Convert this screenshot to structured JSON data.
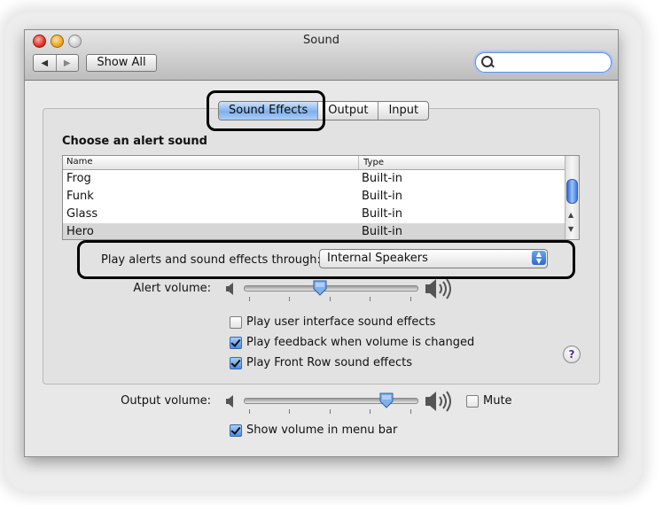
{
  "window": {
    "title": "Sound"
  },
  "toolbar": {
    "nav_back": "◀",
    "nav_forward": "▶",
    "show_all": "Show All",
    "search_value": ""
  },
  "tabs": [
    {
      "label": "Sound Effects",
      "selected": true
    },
    {
      "label": "Output",
      "selected": false
    },
    {
      "label": "Input",
      "selected": false
    }
  ],
  "sound_effects": {
    "heading": "Choose an alert sound",
    "columns": {
      "name": "Name",
      "type": "Type"
    },
    "rows": [
      {
        "name": "Frog",
        "type": "Built-in",
        "selected": false
      },
      {
        "name": "Funk",
        "type": "Built-in",
        "selected": false
      },
      {
        "name": "Glass",
        "type": "Built-in",
        "selected": false
      },
      {
        "name": "Hero",
        "type": "Built-in",
        "selected": true
      }
    ],
    "play_through_label": "Play alerts and sound effects through:",
    "play_through_value": "Internal Speakers",
    "alert_volume_label": "Alert volume:",
    "alert_volume_level": 0.44,
    "checkboxes": [
      {
        "label": "Play user interface sound effects",
        "checked": false
      },
      {
        "label": "Play feedback when volume is changed",
        "checked": true
      },
      {
        "label": "Play Front Row sound effects",
        "checked": true
      }
    ],
    "help": "?"
  },
  "output_volume": {
    "label": "Output volume:",
    "level": 0.85,
    "mute_label": "Mute",
    "mute_checked": false,
    "show_in_menu_bar_label": "Show volume in menu bar",
    "show_in_menu_bar_checked": true
  },
  "colors": {
    "accent": "#5b9ce8",
    "window_bg": "#e8e8e8"
  },
  "icons": [
    "close-icon",
    "minimize-icon",
    "zoom-icon",
    "search-icon",
    "speaker-low-icon",
    "speaker-high-icon",
    "help-icon",
    "popup-arrows-icon",
    "check-icon"
  ]
}
